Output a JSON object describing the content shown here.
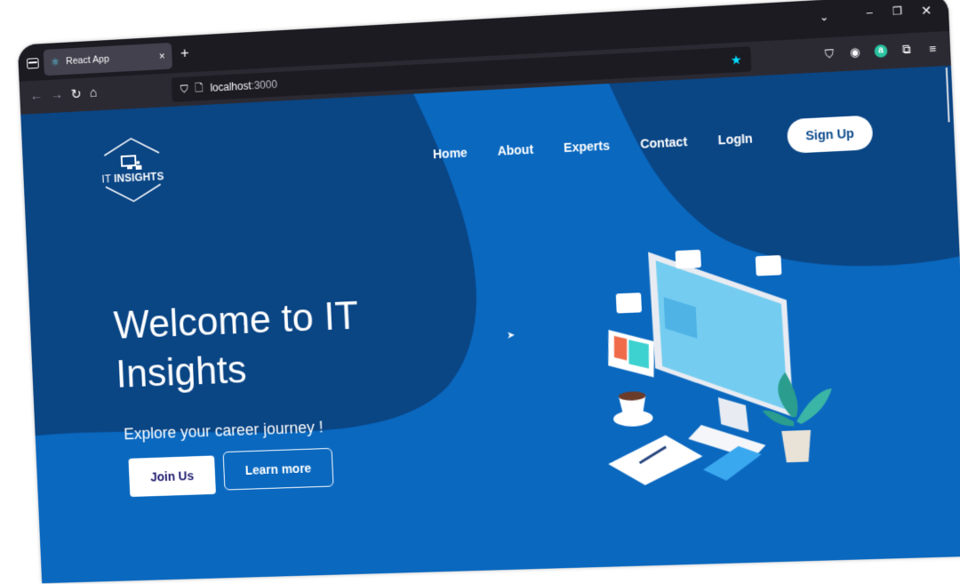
{
  "browser": {
    "tab": {
      "title": "React App",
      "favicon": "react-atom-icon",
      "close": "×"
    },
    "new_tab": "+",
    "tabs_dropdown": "⌄",
    "window_controls": {
      "minimize": "–",
      "restore": "❐",
      "close": "✕"
    },
    "nav": {
      "back": "←",
      "forward": "→",
      "reload": "↻",
      "home": "⌂"
    },
    "url": {
      "host": "localhost",
      "port": ":3000"
    },
    "icons": {
      "shield": "⛉",
      "page": "🗋",
      "bookmark_star": "★",
      "pocket": "⛉",
      "account": "◉",
      "extension_a": "a",
      "extensions": "⧉",
      "menu": "≡"
    }
  },
  "site": {
    "logo": {
      "prefix": "IT",
      "name": "INSIGHTS"
    },
    "nav": [
      "Home",
      "About",
      "Experts",
      "Contact",
      "LogIn"
    ],
    "signup_label": "Sign Up",
    "hero": {
      "title": "Welcome to IT Insights",
      "subtitle": "Explore your career journey !",
      "primary_cta": "Join Us",
      "secondary_cta": "Learn more"
    },
    "colors": {
      "dark_blue": "#0a4584",
      "bright_blue": "#0b72c9",
      "button_text_dark": "#1d1a6e"
    }
  }
}
